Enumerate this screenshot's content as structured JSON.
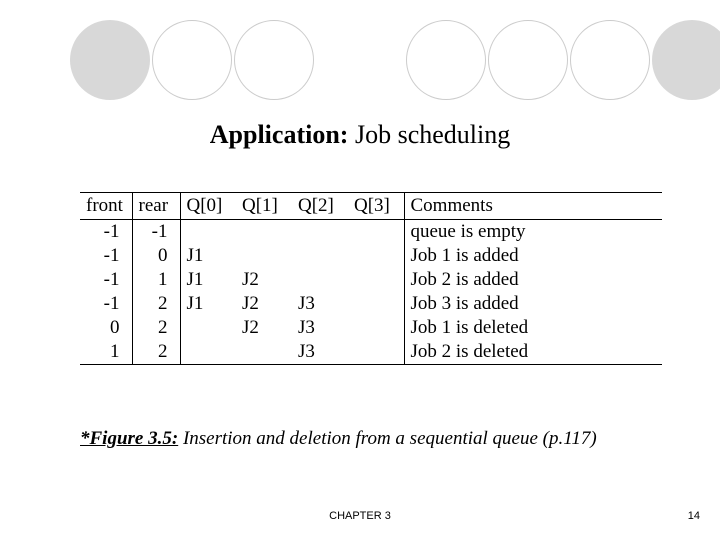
{
  "title": {
    "bold": "Application:",
    "rest": " Job scheduling"
  },
  "headers": {
    "front": "front",
    "rear": "rear",
    "q0": "Q[0]",
    "q1": "Q[1]",
    "q2": "Q[2]",
    "q3": "Q[3]",
    "comments": "Comments"
  },
  "rows": [
    {
      "front": "-1",
      "rear": "-1",
      "q0": "",
      "q1": "",
      "q2": "",
      "q3": "",
      "comment": "queue is empty"
    },
    {
      "front": "-1",
      "rear": "0",
      "q0": "J1",
      "q1": "",
      "q2": "",
      "q3": "",
      "comment": "Job 1 is added"
    },
    {
      "front": "-1",
      "rear": "1",
      "q0": "J1",
      "q1": "J2",
      "q2": "",
      "q3": "",
      "comment": "Job 2 is added"
    },
    {
      "front": "-1",
      "rear": "2",
      "q0": "J1",
      "q1": "J2",
      "q2": "J3",
      "q3": "",
      "comment": "Job 3 is added"
    },
    {
      "front": "0",
      "rear": "2",
      "q0": "",
      "q1": "J2",
      "q2": "J3",
      "q3": "",
      "comment": "Job 1 is deleted"
    },
    {
      "front": "1",
      "rear": "2",
      "q0": "",
      "q1": "",
      "q2": "J3",
      "q3": "",
      "comment": "Job 2 is deleted"
    }
  ],
  "caption": {
    "label": "*Figure 3.5:",
    "text": " Insertion and deletion from a sequential queue (p.117)"
  },
  "footer": {
    "center": "CHAPTER 3",
    "right": "14"
  },
  "chart_data": {
    "type": "table",
    "title": "Application: Job scheduling",
    "columns": [
      "front",
      "rear",
      "Q[0]",
      "Q[1]",
      "Q[2]",
      "Q[3]",
      "Comments"
    ],
    "rows": [
      [
        -1,
        -1,
        "",
        "",
        "",
        "",
        "queue is empty"
      ],
      [
        -1,
        0,
        "J1",
        "",
        "",
        "",
        "Job 1 is added"
      ],
      [
        -1,
        1,
        "J1",
        "J2",
        "",
        "",
        "Job 2 is added"
      ],
      [
        -1,
        2,
        "J1",
        "J2",
        "J3",
        "",
        "Job 3 is added"
      ],
      [
        0,
        2,
        "",
        "J2",
        "J3",
        "",
        "Job 1 is deleted"
      ],
      [
        1,
        2,
        "",
        "",
        "J3",
        "",
        "Job 2 is deleted"
      ]
    ]
  }
}
